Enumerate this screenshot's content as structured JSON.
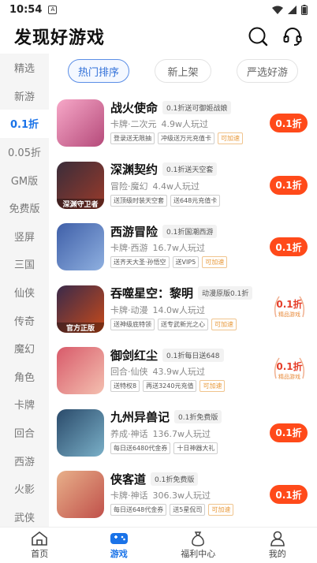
{
  "status": {
    "time": "10:54",
    "notif": "A"
  },
  "header": {
    "title": "发现好游戏"
  },
  "sidebar": {
    "items": [
      {
        "label": "精选"
      },
      {
        "label": "新游"
      },
      {
        "label": "0.1折"
      },
      {
        "label": "0.05折"
      },
      {
        "label": "GM版"
      },
      {
        "label": "免费版"
      },
      {
        "label": "竖屏"
      },
      {
        "label": "三国"
      },
      {
        "label": "仙侠"
      },
      {
        "label": "传奇"
      },
      {
        "label": "魔幻"
      },
      {
        "label": "角色"
      },
      {
        "label": "卡牌"
      },
      {
        "label": "回合"
      },
      {
        "label": "西游"
      },
      {
        "label": "火影"
      },
      {
        "label": "武侠"
      }
    ]
  },
  "tabs": [
    {
      "label": "热门排序"
    },
    {
      "label": "新上架"
    },
    {
      "label": "严选好游"
    }
  ],
  "games": [
    {
      "name": "战火使命",
      "promo": "0.1折送可御姬战娘",
      "genre": "卡牌·二次元",
      "players": "4.9w人玩过",
      "tags": [
        "登录送无限抽",
        "冲级送万元充值卡",
        "可加速"
      ],
      "discount": "0.1折",
      "icon_label": "",
      "colors": [
        "#f7a8c8",
        "#b54a7a"
      ]
    },
    {
      "name": "深渊契约",
      "promo": "0.1折送天空套",
      "genre": "冒险·魔幻",
      "players": "4.4w人玩过",
      "tags": [
        "送顶级时装天空套",
        "送648元充值卡"
      ],
      "discount": "0.1折",
      "icon_label": "深渊守卫者",
      "colors": [
        "#3a2d3a",
        "#9a3a2a"
      ]
    },
    {
      "name": "西游冒险",
      "promo": "0.1折国潮西游",
      "genre": "卡牌·西游",
      "players": "16.7w人玩过",
      "tags": [
        "送齐天大圣·孙悟空",
        "送VIP5",
        "可加速"
      ],
      "discount": "0.1折",
      "icon_label": "",
      "colors": [
        "#3f5fa8",
        "#8fb0e0"
      ]
    },
    {
      "name": "吞噬星空：黎明",
      "promo": "动漫原版0.1折",
      "genre": "卡牌·动漫",
      "players": "14.0w人玩过",
      "tags": [
        "送神级底特领",
        "送专武新光之心",
        "可加速"
      ],
      "discount": "0.1折",
      "discount_sub": "精品游戏",
      "icon_label": "官方正版",
      "colors": [
        "#3a2a4a",
        "#c84a1a"
      ]
    },
    {
      "name": "御剑红尘",
      "promo": "0.1折每日送648",
      "genre": "回合·仙侠",
      "players": "43.9w人玩过",
      "tags": [
        "送特权8",
        "再送3240元充值",
        "可加速"
      ],
      "discount": "0.1折",
      "discount_sub": "精品游戏",
      "icon_label": "",
      "colors": [
        "#d85a6a",
        "#f4c0b0"
      ]
    },
    {
      "name": "九州异兽记",
      "promo": "0.1折免费版",
      "genre": "养成·神话",
      "players": "136.7w人玩过",
      "tags": [
        "每日送6480代金券",
        "十日神器大礼"
      ],
      "discount": "0.1折",
      "icon_label": "",
      "colors": [
        "#2a4a6a",
        "#7ab0c8"
      ]
    },
    {
      "name": "侠客道",
      "promo": "0.1折免费版",
      "genre": "卡牌·神话",
      "players": "306.3w人玩过",
      "tags": [
        "每日送648代金券",
        "送5星侃司",
        "可加速"
      ],
      "discount": "0.1折",
      "icon_label": "",
      "colors": [
        "#e8b08a",
        "#c0504a"
      ]
    }
  ],
  "bottom_nav": [
    {
      "label": "首页"
    },
    {
      "label": "游戏"
    },
    {
      "label": "福利中心"
    },
    {
      "label": "我的"
    }
  ],
  "colors": {
    "accent": "#1a73e8",
    "discount_bg": "#ff4a1a"
  }
}
